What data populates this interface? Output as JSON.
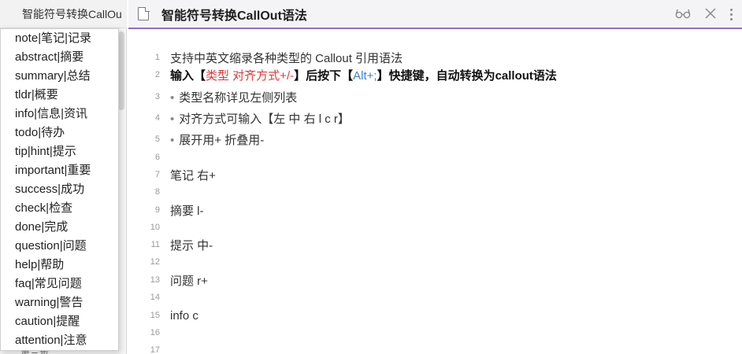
{
  "side_tab": {
    "title": "智能符号转换CallOu"
  },
  "side_peek": "第三步",
  "dropdown": {
    "items": [
      "note|笔记|记录",
      "abstract|摘要",
      "summary|总结",
      "tldr|概要",
      "info|信息|资讯",
      "todo|待办",
      "tip|hint|提示",
      "important|重要",
      "success|成功",
      "check|检查",
      "done|完成",
      "question|问题",
      "help|帮助",
      "faq|常见问题",
      "warning|警告",
      "caution|提醒",
      "attention|注意"
    ]
  },
  "editor": {
    "title": "智能符号转换CallOut语法",
    "icons": [
      "file-icon",
      "glasses-icon",
      "close-icon",
      "more-vertical-icon"
    ],
    "accent": "#8a6fcf",
    "lines": {
      "l1": {
        "no": "1",
        "text": "支持中英文缩录各种类型的 Callout 引用语法"
      },
      "l2": {
        "no": "2",
        "a": "输入【",
        "b": "类型 对齐方式+/-",
        "c": "】后按下【",
        "d": "Alt+;",
        "e": "】快捷键，自动转换为callout语法"
      },
      "l3": {
        "no": "3",
        "bullet": "•",
        "text": "类型名称详见左侧列表"
      },
      "l4": {
        "no": "4",
        "bullet": "•",
        "text": "对齐方式可输入【左 中 右 l c r】"
      },
      "l5": {
        "no": "5",
        "bullet": "•",
        "text": "展开用+ 折叠用-"
      },
      "l6": {
        "no": "6",
        "text": ""
      },
      "l7": {
        "no": "7",
        "text": "笔记 右+"
      },
      "l8": {
        "no": "8",
        "text": ""
      },
      "l9": {
        "no": "9",
        "text": "摘要 l-"
      },
      "l10": {
        "no": "10",
        "text": ""
      },
      "l11": {
        "no": "11",
        "text": "提示 中-"
      },
      "l12": {
        "no": "12",
        "text": ""
      },
      "l13": {
        "no": "13",
        "text": "问题 r+"
      },
      "l14": {
        "no": "14",
        "text": ""
      },
      "l15": {
        "no": "15",
        "text": "info c"
      },
      "l16": {
        "no": "16",
        "text": ""
      },
      "l17": {
        "no": "17",
        "text": ""
      }
    },
    "colors": {
      "red": "#e0393e",
      "blue": "#3b82d6"
    }
  }
}
